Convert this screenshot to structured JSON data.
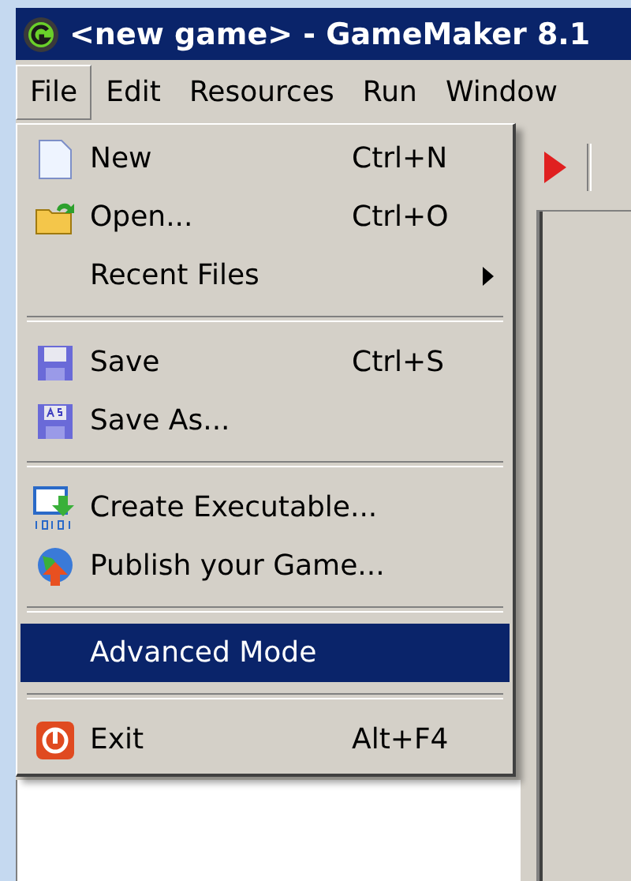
{
  "window": {
    "title": "<new game> - GameMaker 8.1"
  },
  "menu_bar": [
    {
      "label": "File",
      "selected": true
    },
    {
      "label": "Edit",
      "selected": false
    },
    {
      "label": "Resources",
      "selected": false
    },
    {
      "label": "Run",
      "selected": false
    },
    {
      "label": "Window",
      "selected": false
    }
  ],
  "file_menu": [
    {
      "kind": "item",
      "label": "New",
      "shortcut": "Ctrl+N",
      "selected": false
    },
    {
      "kind": "item",
      "label": "Open...",
      "shortcut": "Ctrl+O",
      "selected": false
    },
    {
      "kind": "submenu",
      "label": "Recent Files",
      "selected": false
    },
    {
      "kind": "separator"
    },
    {
      "kind": "item",
      "label": "Save",
      "shortcut": "Ctrl+S",
      "selected": false
    },
    {
      "kind": "item",
      "label": "Save As...",
      "selected": false
    },
    {
      "kind": "separator"
    },
    {
      "kind": "item",
      "label": "Create Executable...",
      "selected": false
    },
    {
      "kind": "item",
      "label": "Publish your Game...",
      "selected": false
    },
    {
      "kind": "separator"
    },
    {
      "kind": "item",
      "label": "Advanced Mode",
      "selected": true
    },
    {
      "kind": "separator"
    },
    {
      "kind": "item",
      "label": "Exit",
      "shortcut": "Alt+F4",
      "selected": false
    }
  ]
}
